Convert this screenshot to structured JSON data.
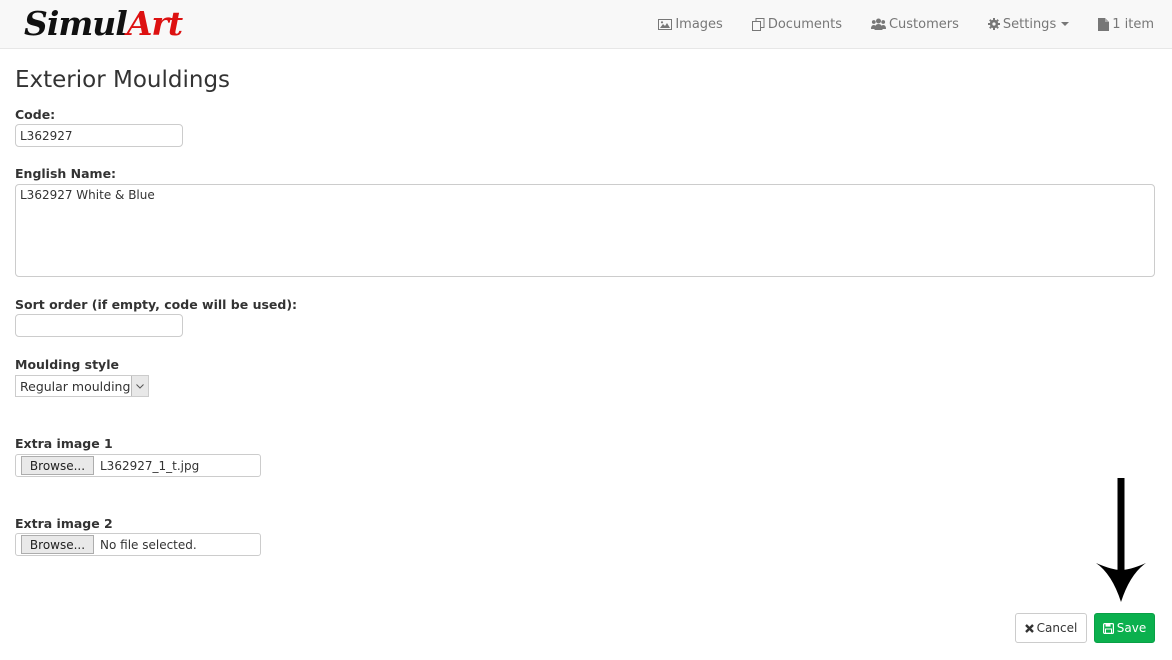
{
  "brand": {
    "part1": "Simul",
    "part2": "Art"
  },
  "nav": {
    "items": [
      {
        "label": "Images",
        "icon": "image-icon"
      },
      {
        "label": "Documents",
        "icon": "documents-icon"
      },
      {
        "label": "Customers",
        "icon": "users-icon"
      },
      {
        "label": "Settings",
        "icon": "gear-icon",
        "dropdown": true
      },
      {
        "label": "1 item",
        "icon": "file-icon"
      }
    ]
  },
  "page": {
    "title": "Exterior Mouldings"
  },
  "form": {
    "code": {
      "label": "Code:",
      "value": "L362927"
    },
    "english_name": {
      "label": "English Name:",
      "value": "L362927 White & Blue"
    },
    "sort_order": {
      "label": "Sort order (if empty, code will be used):",
      "value": ""
    },
    "moulding_style": {
      "label": "Moulding style",
      "selected": "Regular moulding"
    },
    "extra_image_1": {
      "label": "Extra image 1",
      "browse_label": "Browse...",
      "file": "L362927_1_t.jpg"
    },
    "extra_image_2": {
      "label": "Extra image 2",
      "browse_label": "Browse...",
      "file": "No file selected."
    }
  },
  "actions": {
    "cancel_label": "Cancel",
    "save_label": "Save",
    "save_color": "#0bb04e"
  }
}
